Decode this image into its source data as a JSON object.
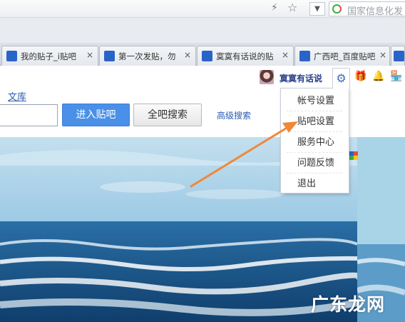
{
  "toolbar": {
    "search_placeholder": "国家信息化发",
    "dropdown_glyph": "▼"
  },
  "tabs": [
    {
      "label": "我的贴子_i贴吧",
      "close": "×"
    },
    {
      "label": "第一次发贴，勿",
      "close": "×"
    },
    {
      "label": "寞寞有话说的贴",
      "close": "×"
    },
    {
      "label": "广西吧_百度贴吧",
      "close": "×"
    },
    {
      "label": "",
      "close": "×"
    }
  ],
  "user": {
    "name": "寞寞有话说"
  },
  "nav": {
    "wenku": "文库"
  },
  "search": {
    "input_value": "",
    "enter_button": "进入贴吧",
    "all_button": "全吧搜索",
    "advanced": "高级搜索"
  },
  "menu": {
    "items": [
      "帐号设置",
      "贴吧设置",
      "服务中心",
      "问题反馈",
      "退出"
    ]
  },
  "icons": {
    "lightning": "lightning-icon",
    "star": "star-icon",
    "gear": "gear-icon",
    "gift": "gift-icon",
    "bell": "bell-icon",
    "store": "store-icon",
    "tab_favicon": "baidu-paw-icon"
  },
  "colors": {
    "accent": "#4a90e8",
    "link": "#2a5bb0",
    "annotation_arrow": "#f0883a"
  },
  "watermark": "广东龙网"
}
